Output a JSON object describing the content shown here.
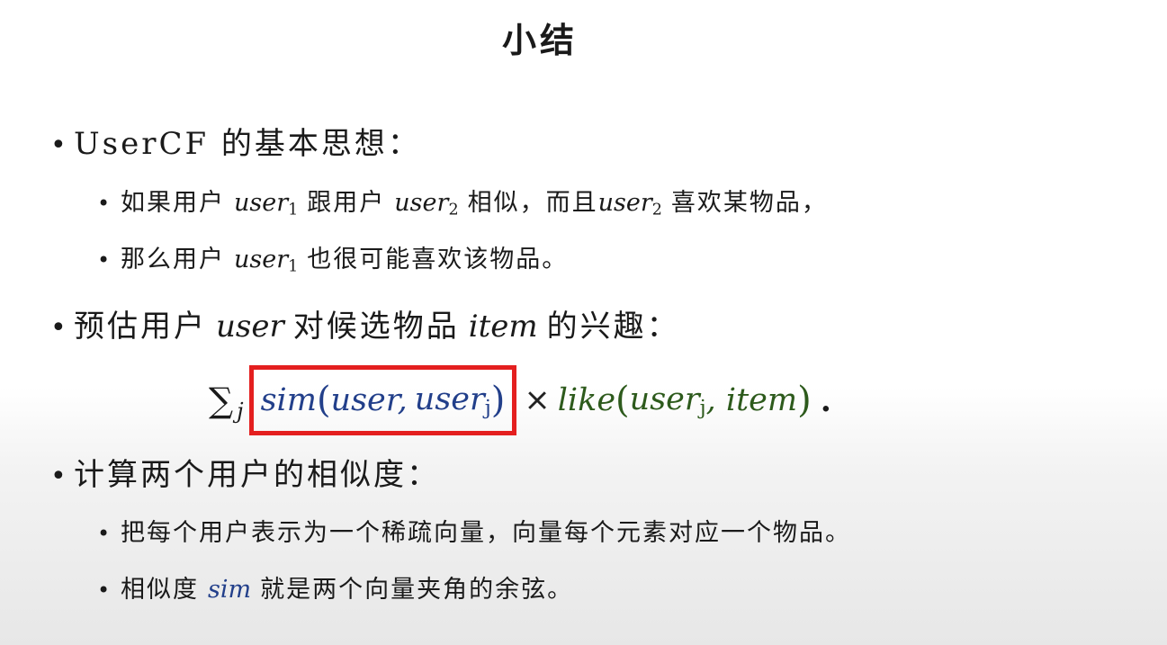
{
  "slide": {
    "title": "小结",
    "bullets": {
      "b1": {
        "prefix": "UserCF",
        "rest": " 的基本思想："
      },
      "b1_sub1": {
        "t1": "如果用户",
        "u1": "user",
        "s1": "1",
        "t2": "跟用户",
        "u2": "user",
        "s2": "2",
        "t3": "相似，而且",
        "u3": "user",
        "s3": "2",
        "t4": "喜欢某物品，"
      },
      "b1_sub2": {
        "t1": "那么用户",
        "u1": "user",
        "s1": "1",
        "t2": "也很可能喜欢该物品。"
      },
      "b2": {
        "t1": "预估用户",
        "m1": "user",
        "t2": "对候选物品",
        "m2": "item",
        "t3": "的兴趣："
      },
      "formula": {
        "sum": "∑",
        "sum_index": "j",
        "sim_fn": "sim",
        "sim_arg1": "user,",
        "sim_arg2": "user",
        "sim_arg2_sub": "j",
        "times": "×",
        "like_fn": "like",
        "like_arg1": "user",
        "like_arg1_sub": "j",
        "like_arg2": ", item",
        "period": ".",
        "highlight_color": "#e41f1f",
        "sim_color": "#223f8a",
        "like_color": "#2d5a1c"
      },
      "b3": {
        "text": "计算两个用户的相似度："
      },
      "b3_sub1": {
        "text": "把每个用户表示为一个稀疏向量，向量每个元素对应一个物品。"
      },
      "b3_sub2": {
        "t1": "相似度",
        "m1": "sim",
        "t2": "就是两个向量夹角的余弦。"
      }
    }
  }
}
